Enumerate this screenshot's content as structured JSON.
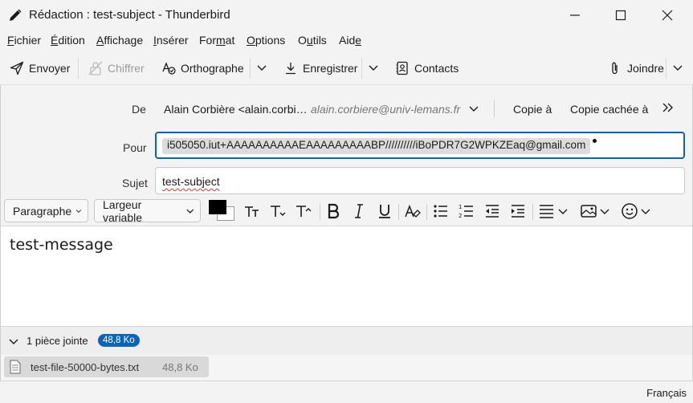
{
  "window": {
    "title": "Rédaction : test-subject - Thunderbird"
  },
  "menubar": {
    "items": [
      {
        "pre": "",
        "key": "F",
        "post": "ichier"
      },
      {
        "pre": "",
        "key": "É",
        "post": "dition"
      },
      {
        "pre": "",
        "key": "A",
        "post": "ffichage"
      },
      {
        "pre": "",
        "key": "I",
        "post": "nsérer"
      },
      {
        "pre": "For",
        "key": "m",
        "post": "at"
      },
      {
        "pre": "",
        "key": "O",
        "post": "ptions"
      },
      {
        "pre": "O",
        "key": "u",
        "post": "tils"
      },
      {
        "pre": "Aid",
        "key": "e",
        "post": ""
      }
    ]
  },
  "toolbar": {
    "send_label": "Envoyer",
    "encrypt_label": "Chiffrer",
    "spelling_label": "Orthographe",
    "save_label": "Enregistrer",
    "contacts_label": "Contacts",
    "attach_label": "Joindre"
  },
  "header": {
    "from_label": "De",
    "from_name": "Alain Corbière <alain.corbi…",
    "from_email": "alain.corbiere@univ-lemans.fr",
    "cc_label": "Copie à",
    "bcc_label": "Copie cachée à",
    "to_label": "Pour",
    "to_recipient": "i505050.iut+AAAAAAAAAAEAAAAAAAAABP//////////iBoPDR7G2WPKZEaq@gmail.com",
    "subject_label": "Sujet",
    "subject_value": "test-subject"
  },
  "format": {
    "paragraph_label": "Paragraphe",
    "font_label": "Largeur variable",
    "fg_color": "#000000",
    "bg_color": "#ffffff"
  },
  "body": {
    "text": "test-message"
  },
  "attachments": {
    "summary_label": "1 pièce jointe",
    "total_size": "48,8 Ko",
    "items": [
      {
        "name": "test-file-50000-bytes.txt",
        "size": "48,8 Ko"
      }
    ]
  },
  "status": {
    "language": "Français"
  },
  "colors": {
    "accent": "#0a64b8",
    "chrome": "#f3f3f3"
  }
}
